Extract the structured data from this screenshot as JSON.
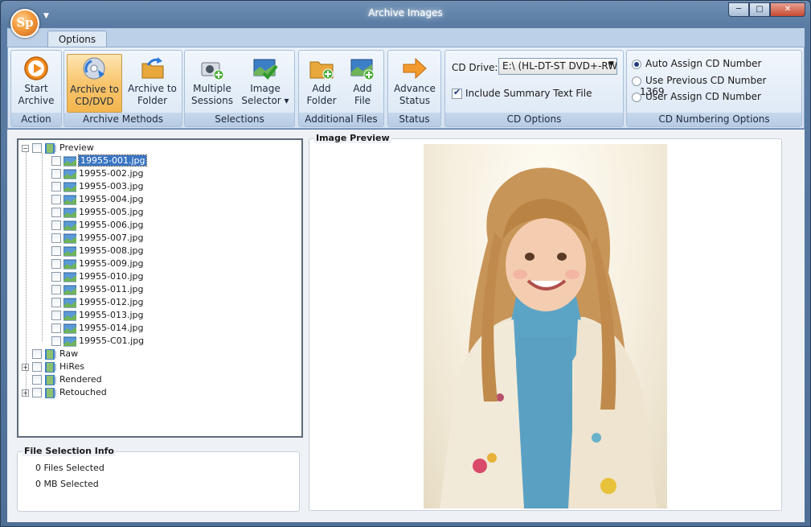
{
  "window": {
    "title": "Archive Images",
    "orb_label": "Sp"
  },
  "window_buttons": {
    "minimize": "─",
    "maximize": "□",
    "close": "✕"
  },
  "ribbon": {
    "tab": "Options",
    "groups": {
      "action": {
        "label": "Action",
        "start_archive": [
          "Start",
          "Archive"
        ]
      },
      "archive_methods": {
        "label": "Archive Methods",
        "to_cd": [
          "Archive to",
          "CD/DVD"
        ],
        "to_folder": [
          "Archive to",
          "Folder"
        ]
      },
      "selections": {
        "label": "Selections",
        "multiple_sessions": [
          "Multiple",
          "Sessions"
        ],
        "image_selector": [
          "Image",
          "Selector ▾"
        ]
      },
      "additional_files": {
        "label": "Additional Files",
        "add_folder": [
          "Add",
          "Folder"
        ],
        "add_file": [
          "Add",
          "File"
        ]
      },
      "status": {
        "label": "Status",
        "advance_status": [
          "Advance",
          "Status"
        ]
      },
      "cd_options": {
        "label": "CD Options",
        "drive_label": "CD Drive:",
        "drive_value": "E:\\ (HL-DT-ST DVD+-RW",
        "include_summary": "Include Summary Text File",
        "include_summary_checked": true
      },
      "cd_numbering": {
        "label": "CD Numbering Options",
        "auto": "Auto Assign CD Number",
        "previous": "Use Previous CD Number",
        "previous_value": "1369",
        "user": "User Assign CD Number",
        "selected": "auto"
      }
    }
  },
  "tree": {
    "root_preview": "Preview",
    "preview_files": [
      "19955-001.jpg",
      "19955-002.jpg",
      "19955-003.jpg",
      "19955-004.jpg",
      "19955-005.jpg",
      "19955-006.jpg",
      "19955-007.jpg",
      "19955-008.jpg",
      "19955-009.jpg",
      "19955-010.jpg",
      "19955-011.jpg",
      "19955-012.jpg",
      "19955-013.jpg",
      "19955-014.jpg",
      "19955-C01.jpg"
    ],
    "selected_file": "19955-001.jpg",
    "other_folders": [
      {
        "name": "Raw",
        "expandable": false
      },
      {
        "name": "HiRes",
        "expandable": true
      },
      {
        "name": "Rendered",
        "expandable": false
      },
      {
        "name": "Retouched",
        "expandable": true
      }
    ]
  },
  "file_selection_info": {
    "title": "File Selection Info",
    "files_selected": "0 Files Selected",
    "mb_selected": "0 MB Selected"
  },
  "preview": {
    "title": "Image Preview"
  },
  "colors": {
    "accent": "#3a75c4",
    "ribbon": "#dbe7f4",
    "selected_button": "#f8c56d"
  }
}
